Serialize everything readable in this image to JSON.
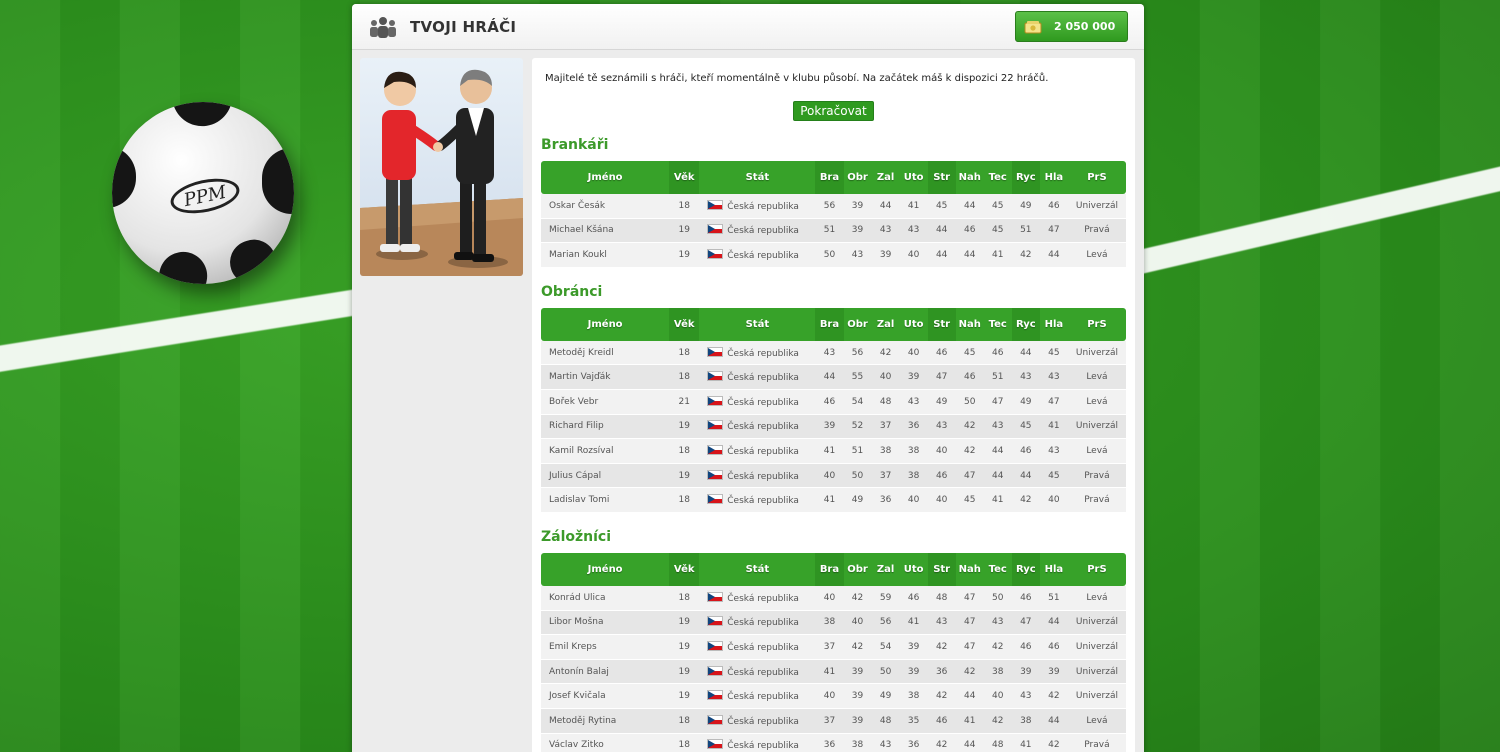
{
  "header": {
    "title": "TVOJI HRÁČI",
    "money": "2 050 000"
  },
  "intro": "Majitelé tě seznámili s hráči, kteří momentálně v klubu působí. Na začátek máš k dispozici 22 hráčů.",
  "continue_label": "Pokračovat",
  "ball_logo": "PPM",
  "columns": {
    "name": "Jméno",
    "age": "Věk",
    "country": "Stát",
    "bra": "Bra",
    "obr": "Obr",
    "zal": "Zal",
    "uto": "Uto",
    "str": "Str",
    "nah": "Nah",
    "tec": "Tec",
    "ryc": "Ryc",
    "hla": "Hla",
    "prs": "PrS"
  },
  "sections": [
    {
      "title": "Brankáři",
      "players": [
        {
          "name": "Oskar Česák",
          "age": "18",
          "country": "Česká republika",
          "stats": [
            "56",
            "39",
            "44",
            "41",
            "45",
            "44",
            "45",
            "49",
            "46"
          ],
          "prs": "Univerzál"
        },
        {
          "name": "Michael Kšána",
          "age": "19",
          "country": "Česká republika",
          "stats": [
            "51",
            "39",
            "43",
            "43",
            "44",
            "46",
            "45",
            "51",
            "47"
          ],
          "prs": "Pravá"
        },
        {
          "name": "Marian Koukl",
          "age": "19",
          "country": "Česká republika",
          "stats": [
            "50",
            "43",
            "39",
            "40",
            "44",
            "44",
            "41",
            "42",
            "44"
          ],
          "prs": "Levá"
        }
      ]
    },
    {
      "title": "Obránci",
      "players": [
        {
          "name": "Metoděj Kreidl",
          "age": "18",
          "country": "Česká republika",
          "stats": [
            "43",
            "56",
            "42",
            "40",
            "46",
            "45",
            "46",
            "44",
            "45"
          ],
          "prs": "Univerzál"
        },
        {
          "name": "Martin Vajďák",
          "age": "18",
          "country": "Česká republika",
          "stats": [
            "44",
            "55",
            "40",
            "39",
            "47",
            "46",
            "51",
            "43",
            "43"
          ],
          "prs": "Levá"
        },
        {
          "name": "Bořek Vebr",
          "age": "21",
          "country": "Česká republika",
          "stats": [
            "46",
            "54",
            "48",
            "43",
            "49",
            "50",
            "47",
            "49",
            "47"
          ],
          "prs": "Levá"
        },
        {
          "name": "Richard Filip",
          "age": "19",
          "country": "Česká republika",
          "stats": [
            "39",
            "52",
            "37",
            "36",
            "43",
            "42",
            "43",
            "45",
            "41"
          ],
          "prs": "Univerzál"
        },
        {
          "name": "Kamil Rozsíval",
          "age": "18",
          "country": "Česká republika",
          "stats": [
            "41",
            "51",
            "38",
            "38",
            "40",
            "42",
            "44",
            "46",
            "43"
          ],
          "prs": "Levá"
        },
        {
          "name": "Julius Cápal",
          "age": "19",
          "country": "Česká republika",
          "stats": [
            "40",
            "50",
            "37",
            "38",
            "46",
            "47",
            "44",
            "44",
            "45"
          ],
          "prs": "Pravá"
        },
        {
          "name": "Ladislav Tomi",
          "age": "18",
          "country": "Česká republika",
          "stats": [
            "41",
            "49",
            "36",
            "40",
            "40",
            "45",
            "41",
            "42",
            "40"
          ],
          "prs": "Pravá"
        }
      ]
    },
    {
      "title": "Záložníci",
      "players": [
        {
          "name": "Konrád Ulica",
          "age": "18",
          "country": "Česká republika",
          "stats": [
            "40",
            "42",
            "59",
            "46",
            "48",
            "47",
            "50",
            "46",
            "51"
          ],
          "prs": "Levá"
        },
        {
          "name": "Libor Mošna",
          "age": "19",
          "country": "Česká republika",
          "stats": [
            "38",
            "40",
            "56",
            "41",
            "43",
            "47",
            "43",
            "47",
            "44"
          ],
          "prs": "Univerzál"
        },
        {
          "name": "Emil Kreps",
          "age": "19",
          "country": "Česká republika",
          "stats": [
            "37",
            "42",
            "54",
            "39",
            "42",
            "47",
            "42",
            "46",
            "46"
          ],
          "prs": "Univerzál"
        },
        {
          "name": "Antonín Balaj",
          "age": "19",
          "country": "Česká republika",
          "stats": [
            "41",
            "39",
            "50",
            "39",
            "36",
            "42",
            "38",
            "39",
            "39"
          ],
          "prs": "Univerzál"
        },
        {
          "name": "Josef Kvičala",
          "age": "19",
          "country": "Česká republika",
          "stats": [
            "40",
            "39",
            "49",
            "38",
            "42",
            "44",
            "40",
            "43",
            "42"
          ],
          "prs": "Univerzál"
        },
        {
          "name": "Metoděj Rytina",
          "age": "18",
          "country": "Česká republika",
          "stats": [
            "37",
            "39",
            "48",
            "35",
            "46",
            "41",
            "42",
            "38",
            "44"
          ],
          "prs": "Levá"
        },
        {
          "name": "Václav Zitko",
          "age": "18",
          "country": "Česká republika",
          "stats": [
            "36",
            "38",
            "43",
            "36",
            "42",
            "44",
            "48",
            "41",
            "42"
          ],
          "prs": "Pravá"
        }
      ]
    }
  ]
}
